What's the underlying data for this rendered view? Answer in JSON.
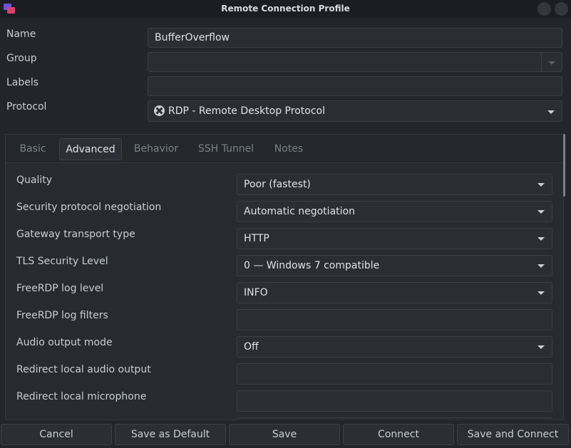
{
  "window": {
    "title": "Remote Connection Profile",
    "icon": "remmina-app-icon"
  },
  "form": {
    "name": {
      "label": "Name",
      "value": "BufferOverflow"
    },
    "group": {
      "label": "Group",
      "value": ""
    },
    "labels": {
      "label": "Labels",
      "value": ""
    },
    "protocol": {
      "label": "Protocol",
      "value": "RDP - Remote Desktop Protocol",
      "icon": "rdp-protocol-icon"
    }
  },
  "tabs": [
    "Basic",
    "Advanced",
    "Behavior",
    "SSH Tunnel",
    "Notes"
  ],
  "active_tab": "Advanced",
  "advanced": {
    "quality": {
      "label": "Quality",
      "value": "Poor (fastest)"
    },
    "security": {
      "label": "Security protocol negotiation",
      "value": "Automatic negotiation"
    },
    "gateway": {
      "label": "Gateway transport type",
      "value": "HTTP"
    },
    "tls": {
      "label": "TLS Security Level",
      "value": "0 — Windows 7 compatible"
    },
    "loglevel": {
      "label": "FreeRDP log level",
      "value": "INFO"
    },
    "logfilters": {
      "label": "FreeRDP log filters",
      "value": ""
    },
    "audio": {
      "label": "Audio output mode",
      "value": "Off"
    },
    "redirect_audio": {
      "label": "Redirect local audio output",
      "value": ""
    },
    "redirect_mic": {
      "label": "Redirect local microphone",
      "value": ""
    }
  },
  "buttons": {
    "cancel": "Cancel",
    "save_default": "Save as Default",
    "save": "Save",
    "connect": "Connect",
    "save_connect": "Save and Connect"
  }
}
